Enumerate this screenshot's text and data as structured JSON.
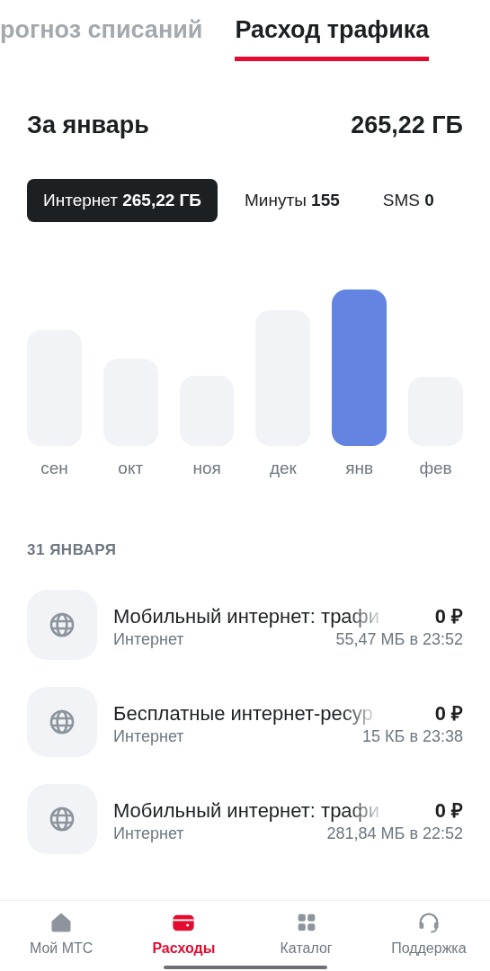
{
  "tabs": [
    {
      "label": "рогноз списаний",
      "selected": false
    },
    {
      "label": "Расход трафика",
      "selected": true
    }
  ],
  "period": {
    "label": "За январь",
    "total": "265,22 ГБ"
  },
  "filters": [
    {
      "label": "Интернет",
      "value": "265,22 ГБ",
      "selected": true
    },
    {
      "label": "Минуты",
      "value": "155",
      "selected": false
    },
    {
      "label": "SMS",
      "value": "0",
      "selected": false
    }
  ],
  "months": [
    {
      "label": "сен",
      "selected": false
    },
    {
      "label": "окт",
      "selected": false
    },
    {
      "label": "ноя",
      "selected": false
    },
    {
      "label": "дек",
      "selected": false
    },
    {
      "label": "янв",
      "selected": true
    },
    {
      "label": "фев",
      "selected": false
    }
  ],
  "date_header": "31 ЯНВАРЯ",
  "entries": [
    {
      "title": "Мобильный интернет: трафи",
      "amount": "0 ₽",
      "category": "Интернет",
      "detail": "55,47 МБ в 23:52"
    },
    {
      "title": "Бесплатные интернет-ресур",
      "amount": "0 ₽",
      "category": "Интернет",
      "detail": "15 КБ в 23:38"
    },
    {
      "title": "Мобильный интернет: трафи",
      "amount": "0 ₽",
      "category": "Интернет",
      "detail": "281,84 МБ в 22:52"
    }
  ],
  "bottom_nav": [
    {
      "label": "Мой МТС",
      "selected": false
    },
    {
      "label": "Расходы",
      "selected": true
    },
    {
      "label": "Каталог",
      "selected": false
    },
    {
      "label": "Поддержка",
      "selected": false
    }
  ]
}
